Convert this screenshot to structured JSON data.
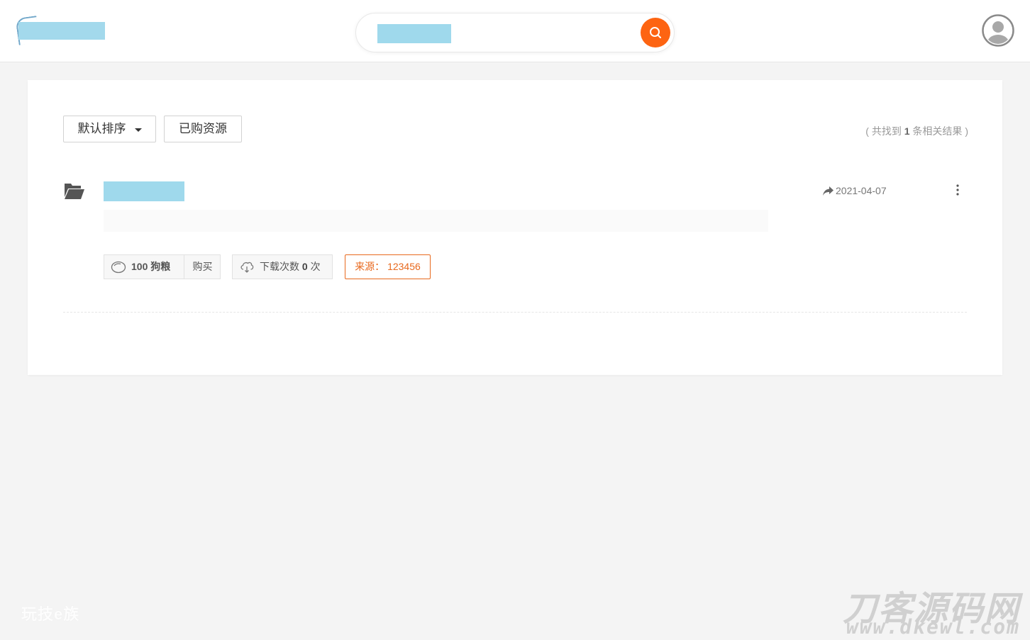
{
  "header": {
    "search_placeholder": "",
    "colors": {
      "accent": "#fd6412",
      "redacted": "#9fd9ec"
    }
  },
  "toolbar": {
    "sort_label": "默认排序",
    "purchased_label": "已购资源",
    "result_prefix": "( 共找到 ",
    "result_count": "1",
    "result_suffix": " 条相关结果 )"
  },
  "resource": {
    "title": "",
    "description": "",
    "date": "2021-04-07",
    "price": "100 狗粮",
    "buy_label": "购买",
    "downloads_prefix": "下载次数 ",
    "downloads_count": "0",
    "downloads_suffix": " 次",
    "source": "来源： 123456"
  },
  "watermarks": {
    "left": "玩技e族",
    "right_cn": "刀客源码网",
    "right_url": "www.dkewl.com"
  },
  "icons": [
    "search-icon",
    "user-avatar-icon",
    "caret-down-icon",
    "folder-open-icon",
    "share-icon",
    "more-vertical-icon",
    "coin-icon",
    "cloud-download-icon"
  ]
}
